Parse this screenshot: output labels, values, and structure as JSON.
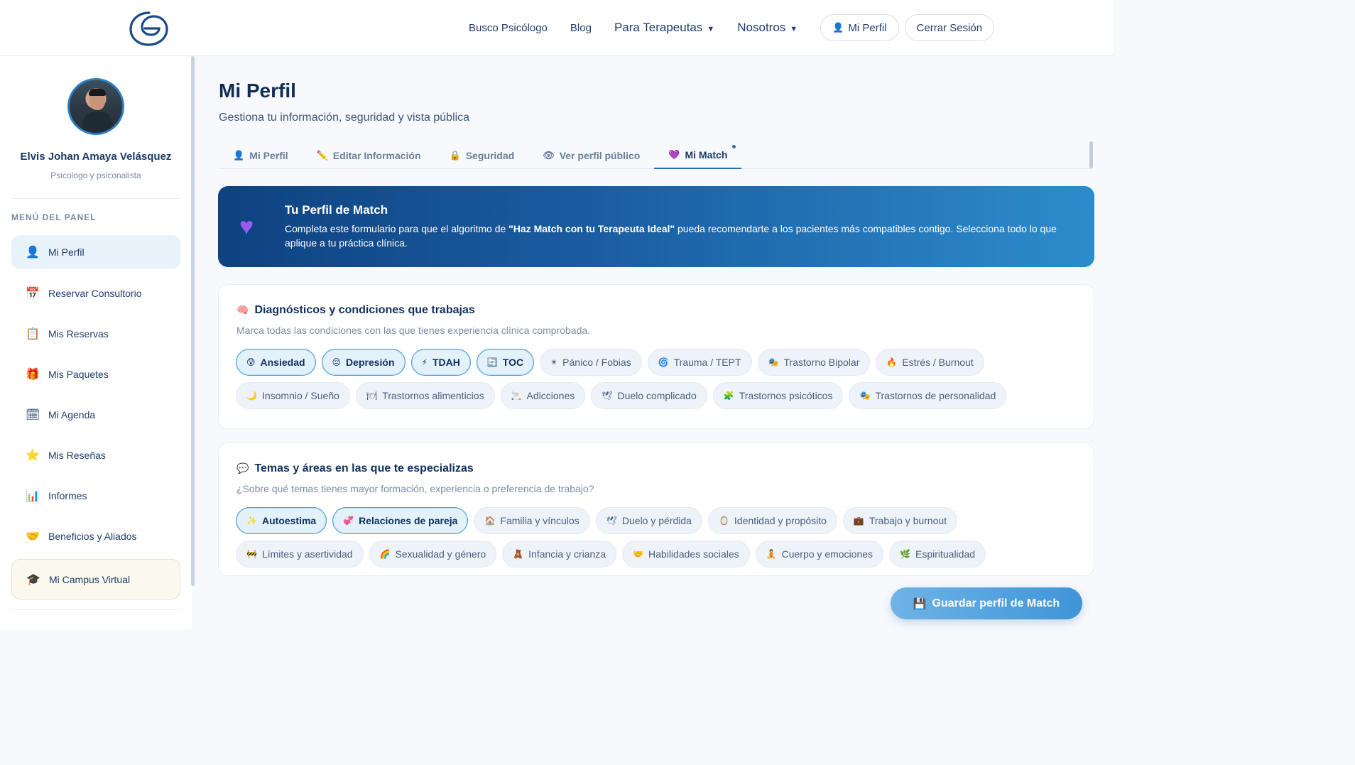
{
  "nav": {
    "links": [
      "Busco Psicólogo",
      "Blog"
    ],
    "dropdowns": [
      "Para Terapeutas",
      "Nosotros"
    ],
    "profile_btn": "Mi Perfil",
    "logout_btn": "Cerrar Sesión"
  },
  "sidebar": {
    "user_name": "Elvis Johan Amaya Velásquez",
    "user_role": "Psicologo y psiconalista",
    "menu_title": "MENÚ DEL PANEL",
    "items": [
      {
        "label": "Mi Perfil",
        "icon": "👤"
      },
      {
        "label": "Reservar Consultorio",
        "icon": "📅"
      },
      {
        "label": "Mis Reservas",
        "icon": "📋"
      },
      {
        "label": "Mis Paquetes",
        "icon": "🎁"
      },
      {
        "label": "Mi Agenda",
        "icon": "🗓"
      },
      {
        "label": "Mis Reseñas",
        "icon": "⭐"
      },
      {
        "label": "Informes",
        "icon": "📊"
      },
      {
        "label": "Beneficios y Aliados",
        "icon": "🤝"
      },
      {
        "label": "Mi Campus Virtual",
        "icon": "🎓"
      }
    ]
  },
  "main": {
    "title": "Mi Perfil",
    "subtitle": "Gestiona tu información, seguridad y vista pública",
    "tabs": [
      {
        "label": "Mi Perfil",
        "icon": "👤"
      },
      {
        "label": "Editar Información",
        "icon": "✏️"
      },
      {
        "label": "Seguridad",
        "icon": "🔒"
      },
      {
        "label": "Ver perfil público",
        "icon": "👁"
      },
      {
        "label": "Mi Match",
        "icon": "💜"
      }
    ]
  },
  "banner": {
    "title": "Tu Perfil de Match",
    "text_before": "Completa este formulario para que el algoritmo de ",
    "text_bold": "\"Haz Match con tu Terapeuta Ideal\"",
    "text_after": " pueda recomendarte a los pacientes más compatibles contigo. Selecciona todo lo que aplique a tu práctica clínica."
  },
  "diagnosticos": {
    "title": "Diagnósticos y condiciones que trabajas",
    "subtitle": "Marca todas las condiciones con las que tienes experiencia clínica comprobada.",
    "chips": [
      {
        "label": "Ansiedad",
        "icon": "😰",
        "selected": true
      },
      {
        "label": "Depresión",
        "icon": "😔",
        "selected": true
      },
      {
        "label": "TDAH",
        "icon": "⚡",
        "selected": true
      },
      {
        "label": "TOC",
        "icon": "🔄",
        "selected": true
      },
      {
        "label": "Pánico / Fobias",
        "icon": "✴",
        "selected": false
      },
      {
        "label": "Trauma / TEPT",
        "icon": "🌀",
        "selected": false
      },
      {
        "label": "Trastorno Bipolar",
        "icon": "🎭",
        "selected": false
      },
      {
        "label": "Estrés / Burnout",
        "icon": "🔥",
        "selected": false
      },
      {
        "label": "Insomnio / Sueño",
        "icon": "🌙",
        "selected": false
      },
      {
        "label": "Trastornos alimenticios",
        "icon": "🍽",
        "selected": false
      },
      {
        "label": "Adicciones",
        "icon": "🚬",
        "selected": false
      },
      {
        "label": "Duelo complicado",
        "icon": "🕊",
        "selected": false
      },
      {
        "label": "Trastornos psicóticos",
        "icon": "🧩",
        "selected": false
      },
      {
        "label": "Trastornos de personalidad",
        "icon": "🎭",
        "selected": false
      }
    ]
  },
  "temas": {
    "title": "Temas y áreas en las que te especializas",
    "subtitle": "¿Sobre qué temas tienes mayor formación, experiencia o preferencia de trabajo?",
    "chips": [
      {
        "label": "Autoestima",
        "icon": "✨",
        "selected": true
      },
      {
        "label": "Relaciones de pareja",
        "icon": "💞",
        "selected": true
      },
      {
        "label": "Familia y vínculos",
        "icon": "🏠",
        "selected": false
      },
      {
        "label": "Duelo y pérdida",
        "icon": "🕊",
        "selected": false
      },
      {
        "label": "Identidad y propósito",
        "icon": "🪞",
        "selected": false
      },
      {
        "label": "Trabajo y burnout",
        "icon": "💼",
        "selected": false
      },
      {
        "label": "Límites y asertividad",
        "icon": "🚧",
        "selected": false
      },
      {
        "label": "Sexualidad y género",
        "icon": "🌈",
        "selected": false
      },
      {
        "label": "Infancia y crianza",
        "icon": "🧸",
        "selected": false
      },
      {
        "label": "Habilidades sociales",
        "icon": "🤝",
        "selected": false
      },
      {
        "label": "Cuerpo y emociones",
        "icon": "🧘",
        "selected": false
      },
      {
        "label": "Espiritualidad",
        "icon": "🌿",
        "selected": false
      }
    ]
  },
  "save_btn": {
    "label": "Guardar perfil de Match",
    "icon": "💾"
  },
  "colors": {
    "accent": "#2a6db5",
    "banner_start": "#0e4280",
    "banner_end": "#2d8ccc",
    "selected_border": "#4a9bd6"
  }
}
